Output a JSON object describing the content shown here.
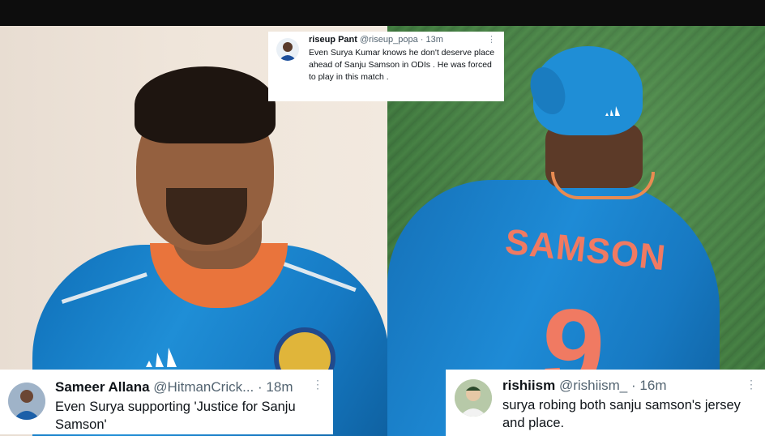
{
  "tweets": {
    "top": {
      "name": "riseup Pant",
      "handle": "@riseup_popa",
      "sep": "·",
      "time": "13m",
      "text": "Even Surya Kumar knows he don't deserve place ahead of Sanju Samson in ODIs . He was forced to play in this match .",
      "more": "⋮"
    },
    "left": {
      "name": "Sameer Allana",
      "handle": "@HitmanCrick...",
      "sep": "·",
      "time": "18m",
      "text": "Even Surya supporting 'Justice for Sanju Samson'",
      "more": "⋮"
    },
    "right": {
      "name": "rishiism",
      "handle": "@rishiism_",
      "sep": "·",
      "time": "16m",
      "text": "surya robing both sanju samson's jersey and place.",
      "more": "⋮"
    }
  },
  "photo": {
    "jersey_name": "SAMSON",
    "jersey_number": "9"
  },
  "colors": {
    "jersey_blue": "#1e8bd6",
    "jersey_print": "#f07a62",
    "collar_orange": "#e9743c",
    "card_bg": "#ffffff",
    "secondary_text": "#536471"
  }
}
